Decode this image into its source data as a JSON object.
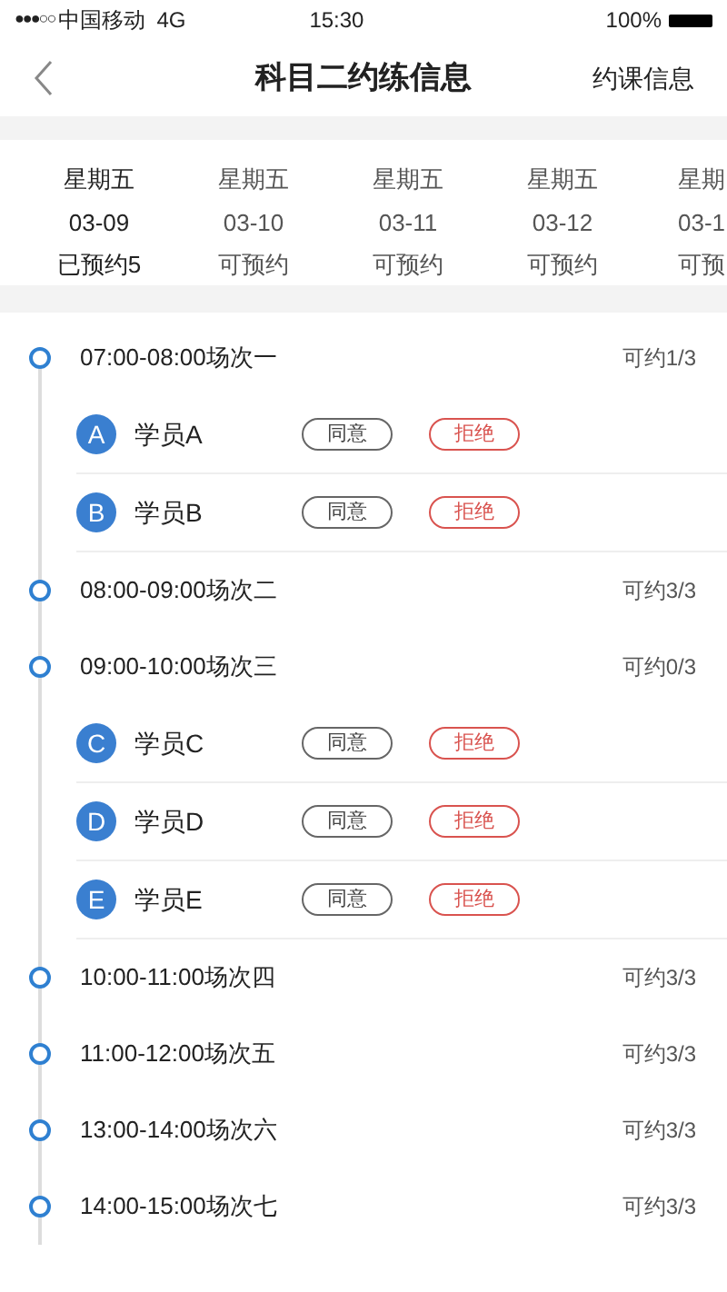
{
  "status_bar": {
    "signal": "●●●○○",
    "carrier": "中国移动",
    "network": "4G",
    "time": "15:30",
    "battery": "100%"
  },
  "nav": {
    "title": "科目二约练信息",
    "action": "约课信息"
  },
  "date_tabs": [
    {
      "weekday": "星期五",
      "date": "03-09",
      "status": "已预约5",
      "selected": true
    },
    {
      "weekday": "星期五",
      "date": "03-10",
      "status": "可预约",
      "selected": false
    },
    {
      "weekday": "星期五",
      "date": "03-11",
      "status": "可预约",
      "selected": false
    },
    {
      "weekday": "星期五",
      "date": "03-12",
      "status": "可预约",
      "selected": false
    },
    {
      "weekday": "星期",
      "date": "03-1",
      "status": "可预",
      "selected": false
    }
  ],
  "slots": [
    {
      "time": "07:00-08:00场次一",
      "availability": "可约1/3",
      "students": [
        {
          "initial": "A",
          "name": "学员A",
          "agree": "同意",
          "reject": "拒绝"
        },
        {
          "initial": "B",
          "name": "学员B",
          "agree": "同意",
          "reject": "拒绝"
        }
      ]
    },
    {
      "time": "08:00-09:00场次二",
      "availability": "可约3/3"
    },
    {
      "time": "09:00-10:00场次三",
      "availability": "可约0/3",
      "students": [
        {
          "initial": "C",
          "name": "学员C",
          "agree": "同意",
          "reject": "拒绝"
        },
        {
          "initial": "D",
          "name": "学员D",
          "agree": "同意",
          "reject": "拒绝"
        },
        {
          "initial": "E",
          "name": "学员E",
          "agree": "同意",
          "reject": "拒绝"
        }
      ]
    },
    {
      "time": "10:00-11:00场次四",
      "availability": "可约3/3"
    },
    {
      "time": "11:00-12:00场次五",
      "availability": "可约3/3"
    },
    {
      "time": "13:00-14:00场次六",
      "availability": "可约3/3"
    },
    {
      "time": "14:00-15:00场次七",
      "availability": "可约3/3"
    }
  ]
}
